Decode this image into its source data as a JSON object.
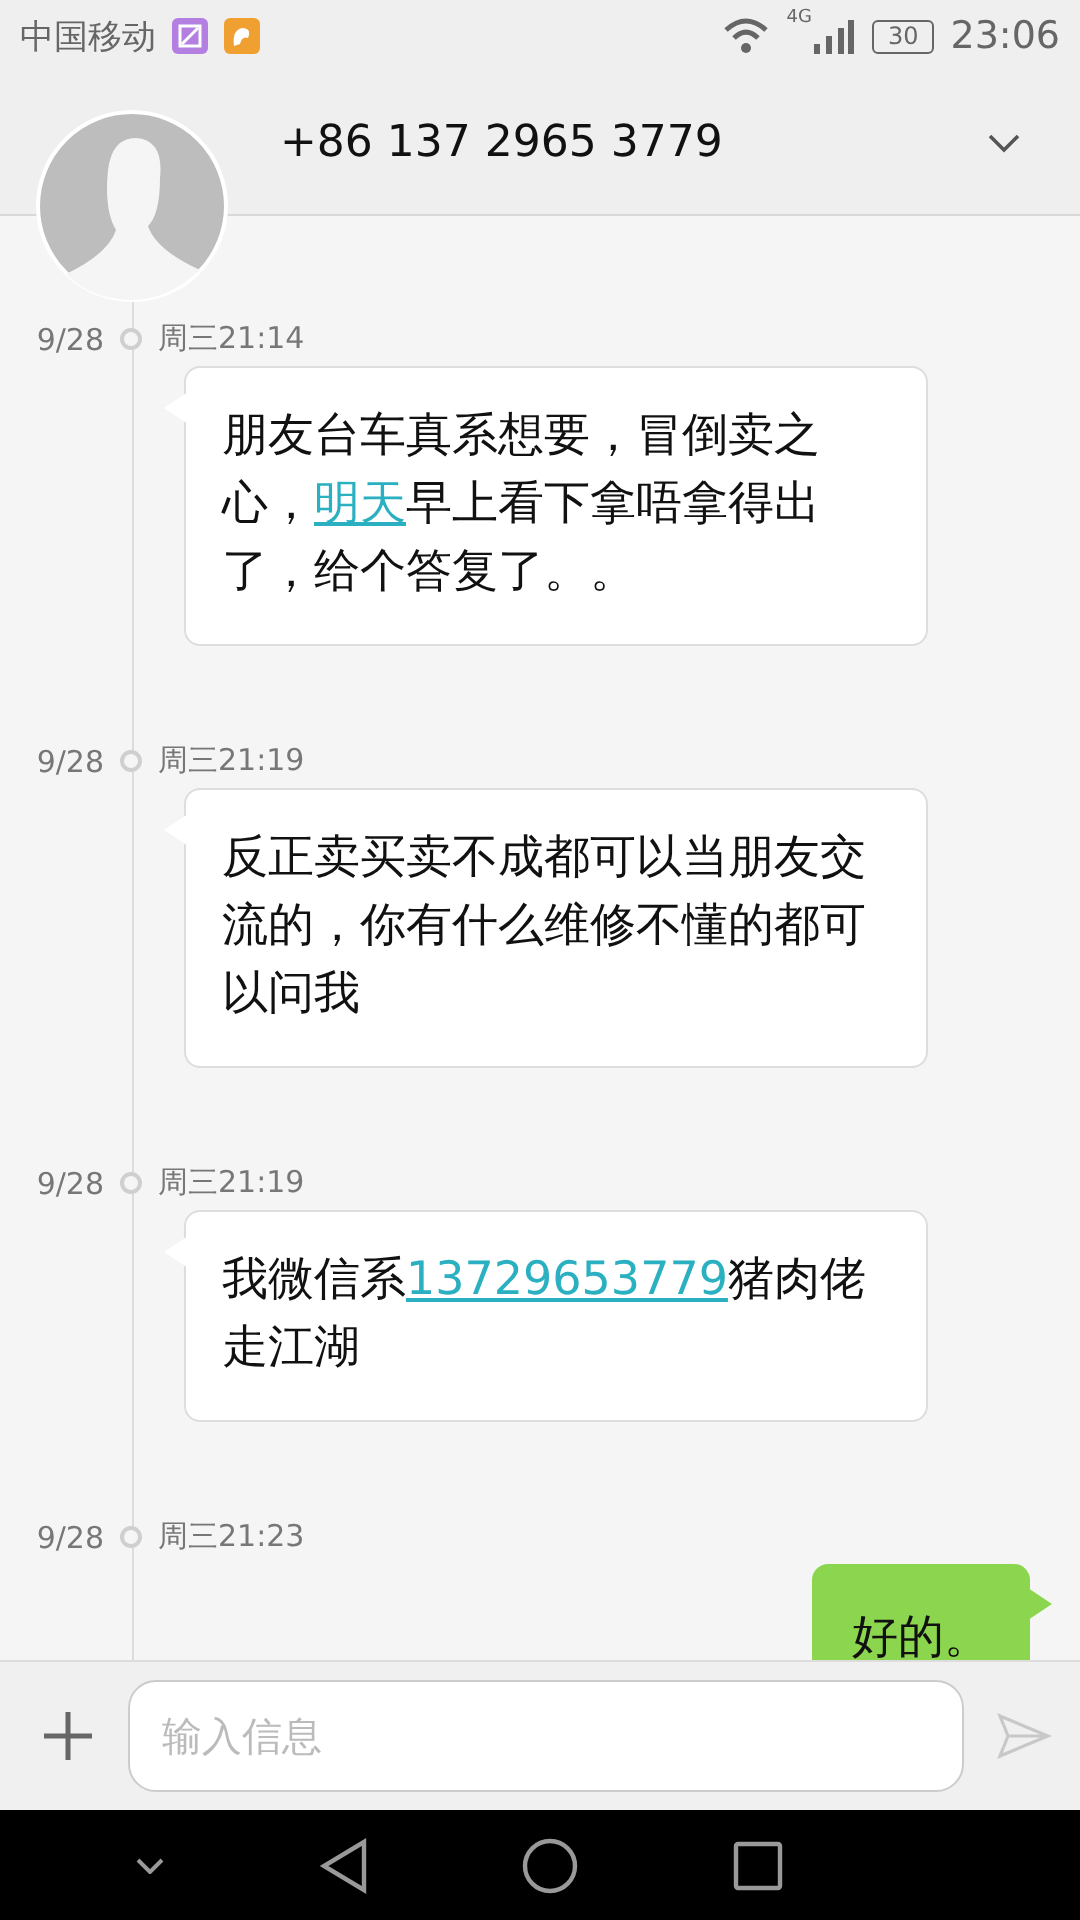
{
  "status_bar": {
    "carrier": "中国移动",
    "network": "4G",
    "battery": "30",
    "time": "23:06"
  },
  "header": {
    "contact": "+86 137 2965 3779"
  },
  "messages": [
    {
      "date": "9/28",
      "time": "周三21:14",
      "kind": "received",
      "segments": [
        {
          "kind": "plain",
          "text": "朋友台车真系想要，冒倒卖之心，"
        },
        {
          "kind": "link",
          "text": "明天"
        },
        {
          "kind": "plain",
          "text": "早上看下拿唔拿得出了，给个答复了。。"
        }
      ]
    },
    {
      "date": "9/28",
      "time": "周三21:19",
      "kind": "received",
      "segments": [
        {
          "kind": "plain",
          "text": "反正卖买卖不成都可以当朋友交流的，你有什么维修不懂的都可以问我"
        }
      ]
    },
    {
      "date": "9/28",
      "time": "周三21:19",
      "kind": "received",
      "segments": [
        {
          "kind": "plain",
          "text": "我微信系"
        },
        {
          "kind": "link",
          "text": "13729653779"
        },
        {
          "kind": "plain",
          "text": "猪肉佬走江湖"
        }
      ]
    },
    {
      "date": "9/28",
      "time": "周三21:23",
      "kind": "sent",
      "segments": [
        {
          "kind": "plain",
          "text": "好的。"
        }
      ]
    }
  ],
  "composer": {
    "placeholder": "输入信息"
  }
}
